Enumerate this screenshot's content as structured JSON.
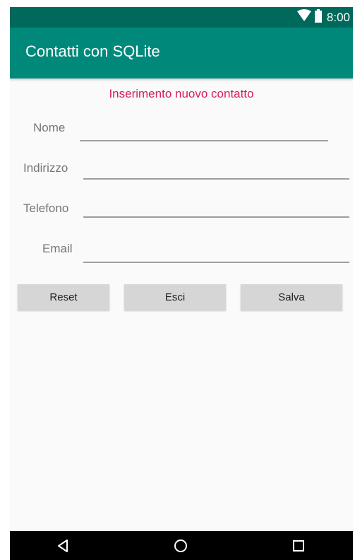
{
  "status_bar": {
    "time": "8:00",
    "icons": [
      "wifi-icon",
      "battery-icon"
    ]
  },
  "app_bar": {
    "title": "Contatti con SQLite"
  },
  "form": {
    "heading": "Inserimento nuovo contatto",
    "fields": [
      {
        "label": "Nome",
        "value": ""
      },
      {
        "label": "Indirizzo",
        "value": ""
      },
      {
        "label": "Telefono",
        "value": ""
      },
      {
        "label": "Email",
        "value": ""
      }
    ]
  },
  "buttons": {
    "reset": "Reset",
    "esci": "Esci",
    "salva": "Salva"
  },
  "nav_bar": {
    "icons": [
      "back-icon",
      "home-icon",
      "recents-icon"
    ]
  },
  "colors": {
    "status_bar": "#00695c",
    "app_bar": "#00897b",
    "heading": "#d81b60",
    "background": "#fafafa",
    "button": "#d6d6d6"
  }
}
